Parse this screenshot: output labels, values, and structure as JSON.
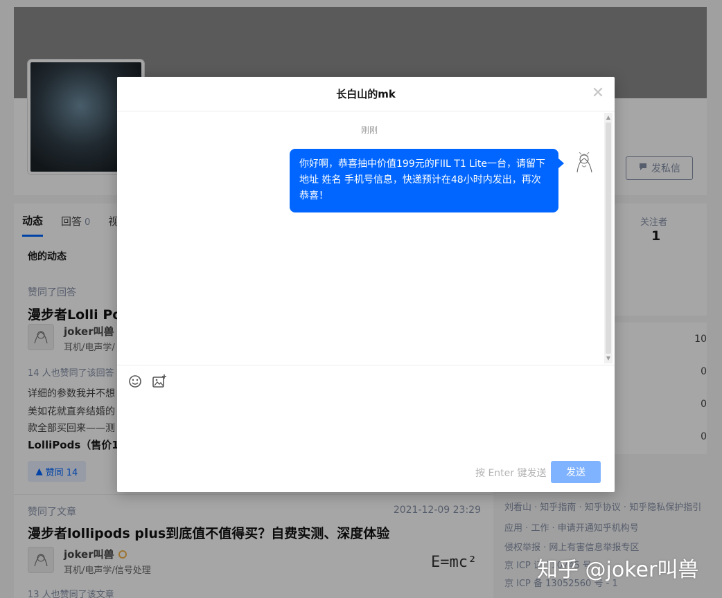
{
  "background": {
    "send_message_label": "发私信",
    "tabs": [
      {
        "label": "动态"
      },
      {
        "label": "回答",
        "count": "0"
      },
      {
        "label": "视"
      }
    ],
    "section_title": "他的动态",
    "feed": [
      {
        "meta": "赞同了回答",
        "title": "漫步者Lolli Po",
        "author": "joker叫兽",
        "bio": "耳机/电声学/",
        "likes_line": "14 人也赞同了该回答",
        "lines": [
          "详细的参数我并不想",
          "美如花就直奔结婚的",
          "款全部买回来——测"
        ],
        "bold_line": "LolliPods（售价1",
        "vote_label": "赞同 14"
      },
      {
        "meta": "赞同了文章",
        "date": "2021-12-09 23:29",
        "title": "漫步者lollipods plus到底值不值得买？自费实测、深度体验",
        "author": "joker叫兽",
        "bio": "耳机/电声学/信号处理",
        "thumb_text": "E=mc²",
        "likes_line": "13 人也赞同了该文章"
      }
    ],
    "stats": {
      "label": "关注者",
      "value": "1"
    },
    "side_counts": [
      "10",
      "0",
      "0",
      "0"
    ],
    "footer_lines": [
      "刘看山 · 知乎指南 · 知乎协议 · 知乎隐私保护指引",
      "应用 · 工作 · 申请开通知乎机构号",
      "侵权举报 · 网上有害信息举报专区",
      "京 ICP 证 110745 号",
      "京 ICP 备 13052560 号 - 1"
    ],
    "watermark": "知乎 @joker叫兽"
  },
  "modal": {
    "title": "长白山的mk",
    "close_icon": "close-icon",
    "timestamp": "刚刚",
    "message": "你好啊，恭喜抽中价值199元的FIIL T1 Lite一台，请留下地址 姓名 手机号信息，快递预计在48小时内发出，再次恭喜！",
    "input_hint": "按 Enter 键发送",
    "send_label": "发送",
    "accent": "#0066ff",
    "send_disabled_color": "#80b3ff"
  }
}
